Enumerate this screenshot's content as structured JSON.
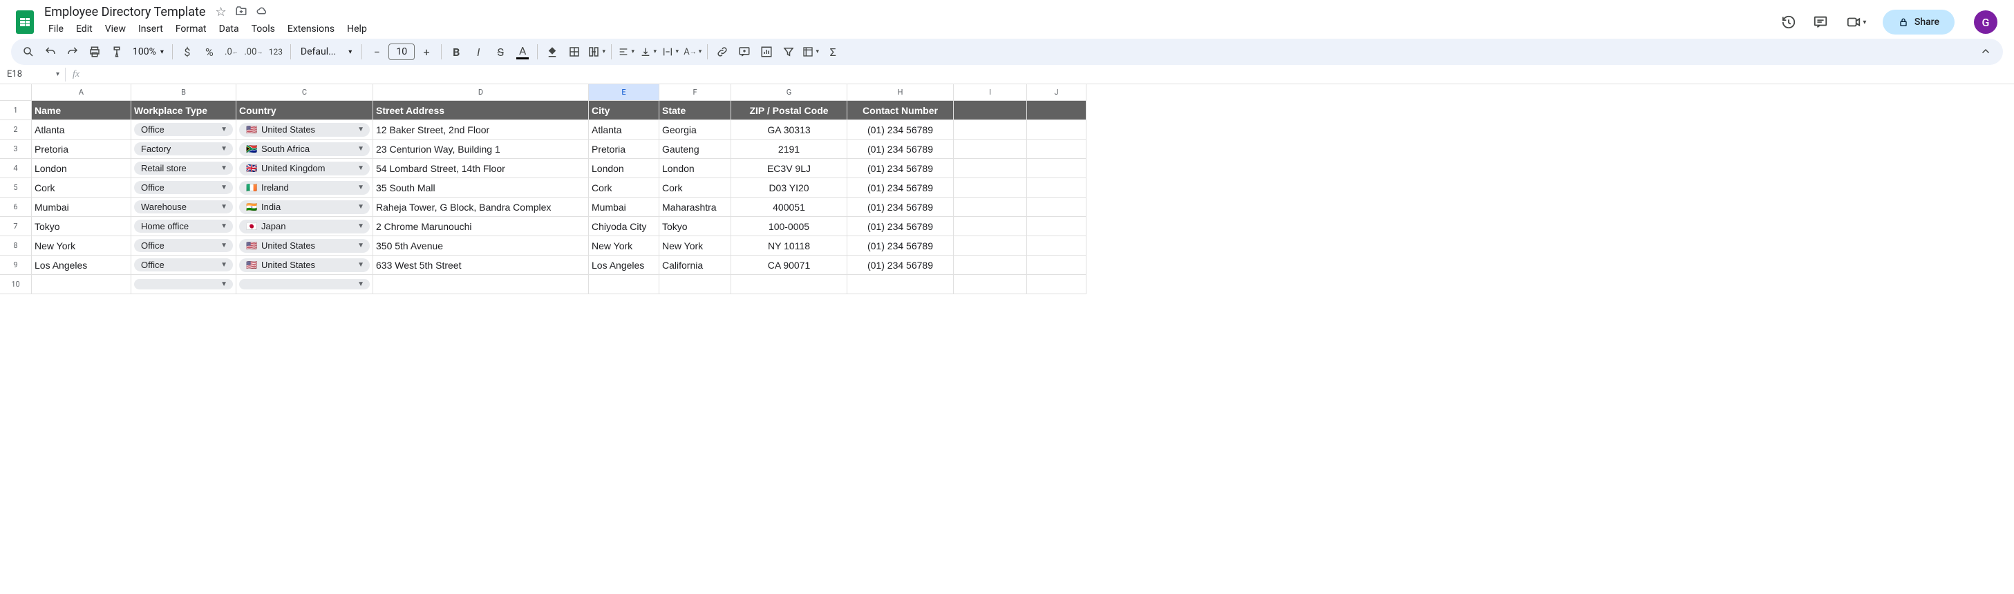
{
  "doc": {
    "title": "Employee Directory Template"
  },
  "menu": {
    "file": "File",
    "edit": "Edit",
    "view": "View",
    "insert": "Insert",
    "format": "Format",
    "data": "Data",
    "tools": "Tools",
    "extensions": "Extensions",
    "help": "Help"
  },
  "toolbar": {
    "zoom": "100%",
    "font": "Defaul...",
    "font_size": "10"
  },
  "share": {
    "label": "Share"
  },
  "account": {
    "initial": "G"
  },
  "namebox": {
    "ref": "E18"
  },
  "columns": [
    "A",
    "B",
    "C",
    "D",
    "E",
    "F",
    "G",
    "H",
    "I",
    "J"
  ],
  "active_col_index": 4,
  "headers": {
    "name": "Name",
    "wtype": "Workplace Type",
    "country": "Country",
    "street": "Street Address",
    "city": "City",
    "state": "State",
    "zip": "ZIP / Postal Code",
    "contact": "Contact Number"
  },
  "rows": [
    {
      "name": "Atlanta",
      "wtype": "Office",
      "flag": "🇺🇸",
      "country": "United States",
      "street": "12 Baker Street, 2nd Floor",
      "city": "Atlanta",
      "state": "Georgia",
      "zip": "GA 30313",
      "contact": "(01) 234 56789"
    },
    {
      "name": "Pretoria",
      "wtype": "Factory",
      "flag": "🇿🇦",
      "country": "South Africa",
      "street": "23 Centurion Way, Building 1",
      "city": "Pretoria",
      "state": "Gauteng",
      "zip": "2191",
      "contact": "(01) 234 56789"
    },
    {
      "name": "London",
      "wtype": "Retail store",
      "flag": "🇬🇧",
      "country": "United Kingdom",
      "street": "54 Lombard Street, 14th Floor",
      "city": "London",
      "state": "London",
      "zip": "EC3V 9LJ",
      "contact": "(01) 234 56789"
    },
    {
      "name": "Cork",
      "wtype": "Office",
      "flag": "🇮🇪",
      "country": "Ireland",
      "street": "35 South Mall",
      "city": "Cork",
      "state": "Cork",
      "zip": "D03 YI20",
      "contact": "(01) 234 56789"
    },
    {
      "name": "Mumbai",
      "wtype": "Warehouse",
      "flag": "🇮🇳",
      "country": "India",
      "street": "Raheja Tower, G Block, Bandra Complex",
      "city": "Mumbai",
      "state": "Maharashtra",
      "zip": "400051",
      "contact": "(01) 234 56789"
    },
    {
      "name": "Tokyo",
      "wtype": "Home office",
      "flag": "🇯🇵",
      "country": "Japan",
      "street": "2 Chrome Marunouchi",
      "city": "Chiyoda City",
      "state": "Tokyo",
      "zip": "100-0005",
      "contact": "(01) 234 56789"
    },
    {
      "name": "New York",
      "wtype": "Office",
      "flag": "🇺🇸",
      "country": "United States",
      "street": "350 5th Avenue",
      "city": "New York",
      "state": "New York",
      "zip": "NY 10118",
      "contact": "(01) 234 56789"
    },
    {
      "name": "Los Angeles",
      "wtype": "Office",
      "flag": "🇺🇸",
      "country": "United States",
      "street": "633 West 5th Street",
      "city": "Los Angeles",
      "state": "California",
      "zip": "CA 90071",
      "contact": "(01) 234 56789"
    }
  ],
  "row_numbers": [
    "1",
    "2",
    "3",
    "4",
    "5",
    "6",
    "7",
    "8",
    "9",
    "10"
  ]
}
